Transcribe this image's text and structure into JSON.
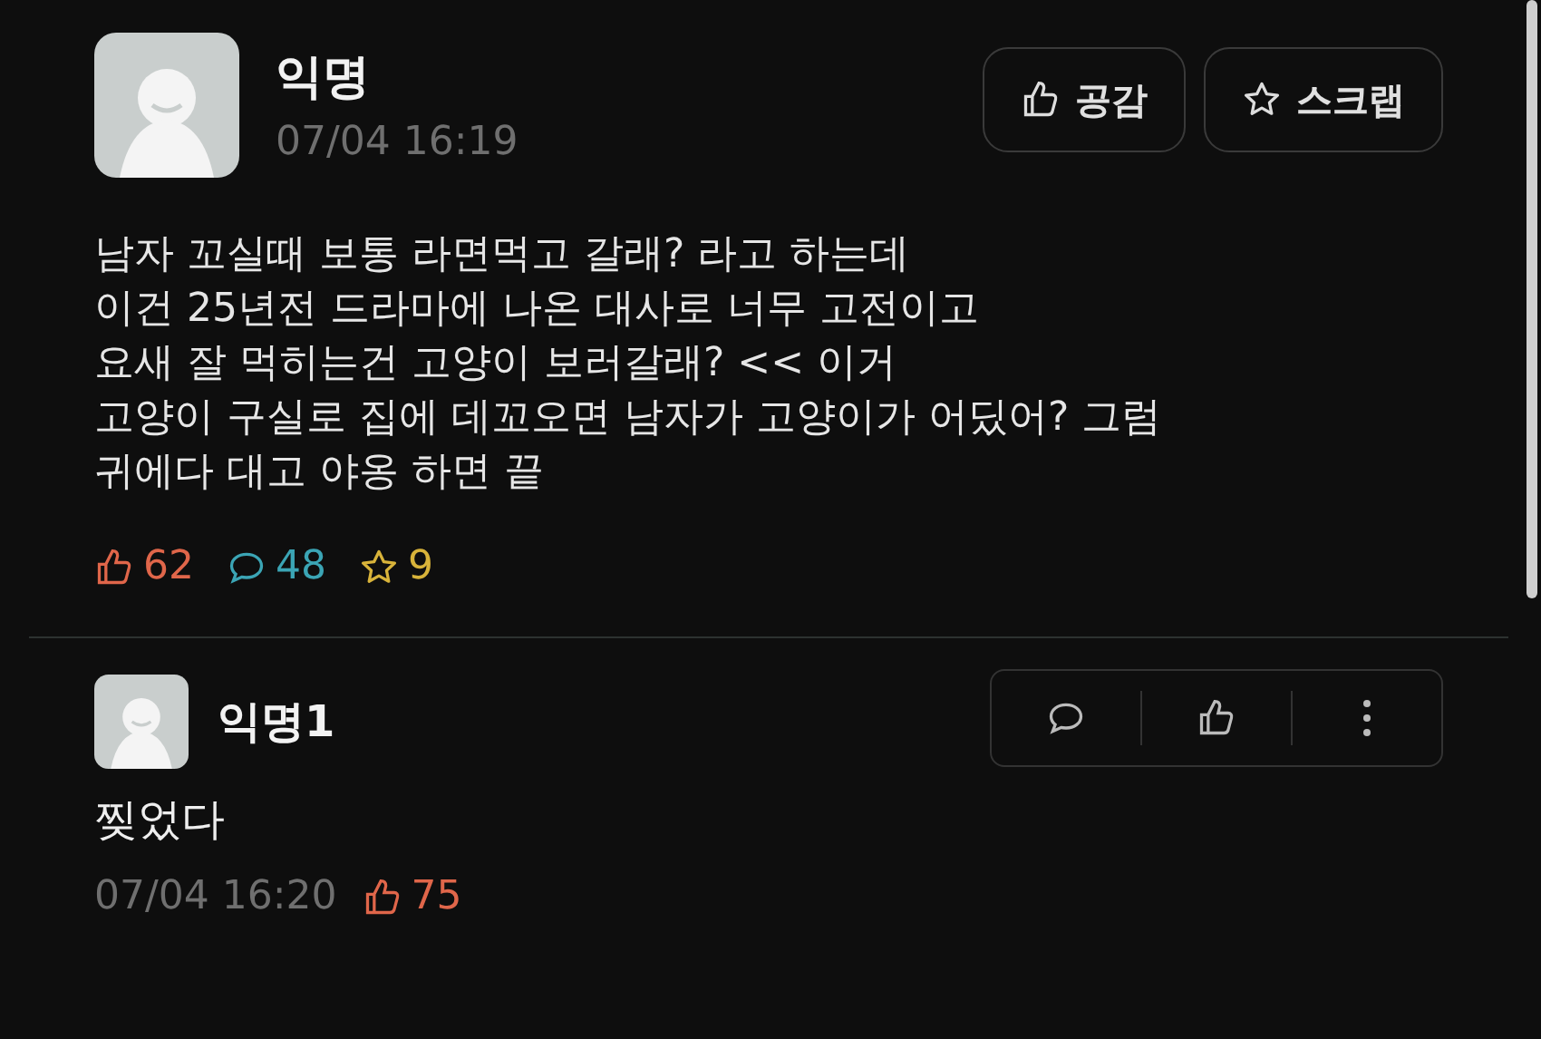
{
  "post": {
    "author": "익명",
    "time": "07/04 16:19",
    "actions": [
      {
        "kind": "like",
        "label": "공감"
      },
      {
        "kind": "scrap",
        "label": "스크랩"
      }
    ],
    "body": [
      "남자 꼬실때 보통 라면먹고 갈래? 라고 하는데",
      "이건 25년전 드라마에 나온 대사로 너무 고전이고",
      "요새 잘 먹히는건 고양이 보러갈래? << 이거",
      "고양이 구실로 집에 데꼬오면 남자가 고양이가 어딨어? 그럼",
      "귀에다 대고 야옹 하면 끝"
    ],
    "stats": [
      {
        "kind": "like",
        "count": "62",
        "color": "#e0664a"
      },
      {
        "kind": "comment",
        "count": "48",
        "color": "#3ba5b5"
      },
      {
        "kind": "scrap",
        "count": "9",
        "color": "#d8b33a"
      }
    ]
  },
  "comments": [
    {
      "author": "익명1",
      "text": "찢었다",
      "time": "07/04 16:20",
      "likes": "75"
    }
  ]
}
